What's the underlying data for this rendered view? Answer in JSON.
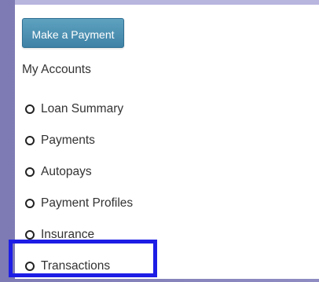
{
  "payment_button": {
    "label": "Make a Payment"
  },
  "accounts_menu": {
    "heading": "My Accounts",
    "items": [
      {
        "label": "Loan Summary",
        "icon": "circle-icon"
      },
      {
        "label": "Payments",
        "icon": "circle-icon"
      },
      {
        "label": "Autopays",
        "icon": "circle-icon"
      },
      {
        "label": "Payment Profiles",
        "icon": "circle-icon"
      },
      {
        "label": "Insurance",
        "icon": "circle-icon"
      },
      {
        "label": "Transactions",
        "icon": "circle-icon"
      }
    ],
    "highlighted_item": "Transactions"
  },
  "colors": {
    "background": "#8f8cc2",
    "button": "#4a8db0",
    "highlight": "#1d1de6"
  }
}
